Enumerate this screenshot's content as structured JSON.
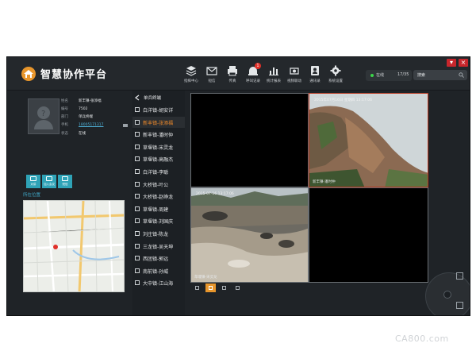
{
  "app": {
    "title": "智慧协作平台",
    "window_buttons": [
      "▾",
      "×"
    ]
  },
  "toolbar": [
    {
      "label": "指挥中心",
      "icon": "layers-icon"
    },
    {
      "label": "短信",
      "icon": "mail-icon"
    },
    {
      "label": "传真",
      "icon": "printer-icon"
    },
    {
      "label": "呼叫记录",
      "icon": "alarm-icon",
      "badge": "1"
    },
    {
      "label": "统计报表",
      "icon": "bar-chart-icon"
    },
    {
      "label": "视频联动",
      "icon": "camera-icon"
    },
    {
      "label": "通讯录",
      "icon": "contact-icon"
    },
    {
      "label": "系统设置",
      "icon": "gear-icon"
    }
  ],
  "status": {
    "label": "在线",
    "count": "17/35",
    "dot_color": "#3bd54a"
  },
  "search": {
    "value": "搜索"
  },
  "profile": {
    "fields": [
      {
        "key": "姓名",
        "value": "新丰镇-张添福"
      },
      {
        "key": "编号",
        "value": "7502"
      },
      {
        "key": "部门",
        "value": "单兵终端"
      },
      {
        "key": "手机",
        "value": "18005171317",
        "link": true
      },
      {
        "key": "状态",
        "value": "在线"
      }
    ]
  },
  "actions": [
    {
      "label": "对讲"
    },
    {
      "label": "加入会议"
    },
    {
      "label": "短信"
    }
  ],
  "location": {
    "title": "所在位置"
  },
  "list": {
    "title": "单兵终端",
    "items": [
      {
        "label": "白洋镇-胡安详",
        "active": false
      },
      {
        "label": "新丰镇-张添福",
        "active": true
      },
      {
        "label": "新丰镇-潘时仲",
        "active": false
      },
      {
        "label": "草堰镇-宋灵龙",
        "active": false
      },
      {
        "label": "草堰镇-高融杰",
        "active": false
      },
      {
        "label": "白洋镇-李聪",
        "active": false
      },
      {
        "label": "大桥镇-叶公",
        "active": false
      },
      {
        "label": "大桥镇-赵峥龙",
        "active": false
      },
      {
        "label": "草堰镇-周建",
        "active": false
      },
      {
        "label": "草堰镇-刘国庆",
        "active": false
      },
      {
        "label": "刘庄镇-陈龙",
        "active": false
      },
      {
        "label": "三龙镇-吴天坤",
        "active": false
      },
      {
        "label": "西团镇-郭远",
        "active": false
      },
      {
        "label": "南前镇-孙威",
        "active": false
      },
      {
        "label": "大中镇-江山海",
        "active": false
      }
    ]
  },
  "videos": [
    {
      "caption": "",
      "time": "",
      "kind": "empty"
    },
    {
      "caption": "新丰镇-潘时仲",
      "time": "2015年07月16日 星期四 13:17:06",
      "kind": "landslide"
    },
    {
      "caption": "草堰镇-宋灵龙",
      "time": "2015-07-16 13:17:06",
      "kind": "flood"
    },
    {
      "caption": "",
      "time": "",
      "kind": "empty"
    }
  ],
  "layout_options": [
    "1x1",
    "2x2",
    "3x3",
    "4x4"
  ],
  "layout_selected": 1,
  "watermark": "CA800.com",
  "colors": {
    "accent": "#e8962c",
    "link": "#4fb1d8",
    "active_item": "#f08a2a",
    "button": "#2fa3b7",
    "badge": "#e0312a"
  }
}
